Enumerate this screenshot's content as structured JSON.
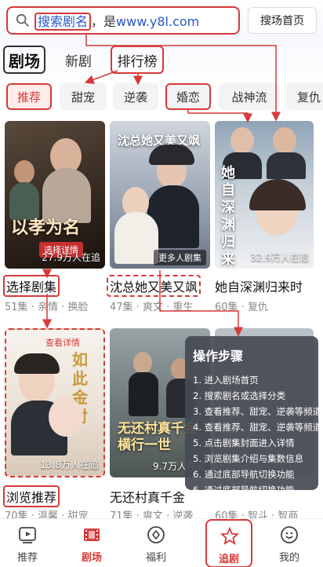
{
  "search": {
    "highlight_text": "搜索剧名",
    "separator": "，是",
    "url_text": "www.y8l.com",
    "home_button": "搜场首页"
  },
  "tabs": {
    "main": "剧场",
    "new": "新剧",
    "rank": "排行榜"
  },
  "categories": [
    "推荐",
    "甜宠",
    "逆袭",
    "婚恋",
    "战神流",
    "复仇"
  ],
  "cards": [
    {
      "art_title": "以孝为名",
      "badge": "选择详情",
      "views": "27.9万人在追",
      "title": "选择剧集",
      "meta": "51集 · 亲情 · 换脸"
    },
    {
      "art_title": "沈总她又美又飒",
      "badge": "更多人剧集",
      "views": "",
      "title": "沈总她又美又飒",
      "meta": "47集 · 爽文 · 重生"
    },
    {
      "art_title": "她自深渊归来时",
      "badge": "",
      "views": "32.9万人在追",
      "title": "她自深渊归来时",
      "meta": "60集 · 复仇"
    },
    {
      "art_title": "如此金对",
      "badge": "查看详情",
      "views": "13.8万人在追",
      "title": "浏览推荐",
      "meta": "70集 · 温馨 · 甜宠"
    },
    {
      "art_title": "无还村真千金横行一世",
      "badge": "",
      "views": "9.7万人在追",
      "title": "无还村真千金",
      "meta": "71集 · 爽文 · 逆袭"
    },
    {
      "art_title": "",
      "badge": "",
      "views": "",
      "title": "",
      "meta": "60集 · 智斗 · 智商"
    }
  ],
  "steps": {
    "title": "操作步骤",
    "items": [
      "1. 进入剧场首页",
      "2. 搜索剧名或选择分类",
      "3. 查看推荐、甜宠、逆袭等频道",
      "4. 查看推荐、甜宠、逆袭等频道",
      "5. 点击剧集封面进入详情",
      "5. 浏览剧集介绍与集数信息",
      "6. 通过底部导航切换功能",
      "6. 通过底部导航切换功能"
    ]
  },
  "nav": [
    {
      "label": "推荐",
      "icon": "play-square-icon"
    },
    {
      "label": "剧场",
      "icon": "film-icon"
    },
    {
      "label": "福利",
      "icon": "gift-circle-icon"
    },
    {
      "label": "追剧",
      "icon": "star-icon"
    },
    {
      "label": "我的",
      "icon": "smile-icon"
    }
  ],
  "colors": {
    "accent": "#d63a3a",
    "link": "#2a57c8"
  }
}
